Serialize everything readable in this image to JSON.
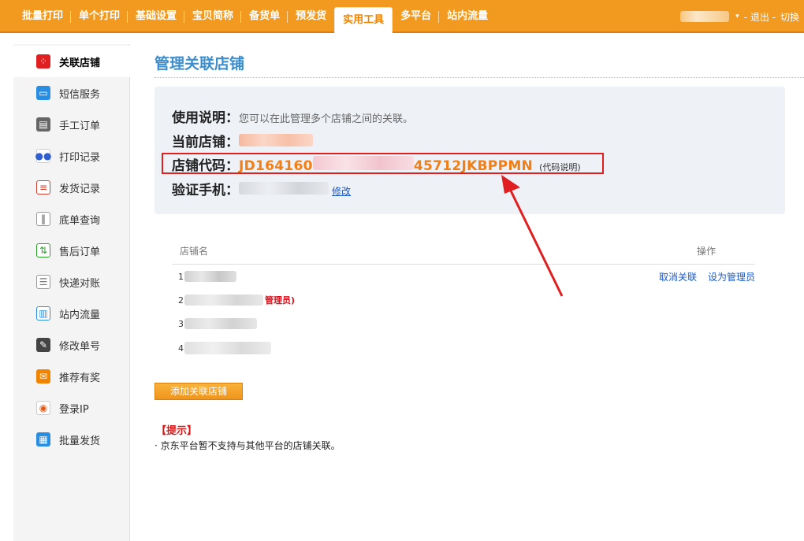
{
  "nav": {
    "items": [
      "批量打印",
      "单个打印",
      "基础设置",
      "宝贝简称",
      "备货单",
      "预发货",
      "实用工具",
      "多平台",
      "站内流量"
    ],
    "active_index": 6
  },
  "user": {
    "caret": "▾",
    "logout": "- 退出 -",
    "switch": "切换"
  },
  "sidebar": {
    "items": [
      {
        "label": "关联店铺",
        "icon": "store-link-icon",
        "color": "#e02020",
        "active": true
      },
      {
        "label": "短信服务",
        "icon": "sms-icon",
        "color": "#2a8ee0"
      },
      {
        "label": "手工订单",
        "icon": "printer-icon",
        "color": "#666666"
      },
      {
        "label": "打印记录",
        "icon": "print-record-icon",
        "color": "#3060d0"
      },
      {
        "label": "发货记录",
        "icon": "shipping-record-icon",
        "color": "#d04030"
      },
      {
        "label": "底单查询",
        "icon": "barcode-icon",
        "color": "#666666"
      },
      {
        "label": "售后订单",
        "icon": "after-sale-icon",
        "color": "#2aa02a"
      },
      {
        "label": "快递对账",
        "icon": "reconcile-icon",
        "color": "#777777"
      },
      {
        "label": "站内流量",
        "icon": "traffic-chart-icon",
        "color": "#2a8ee0"
      },
      {
        "label": "修改单号",
        "icon": "edit-pencil-icon",
        "color": "#444444"
      },
      {
        "label": "推荐有奖",
        "icon": "reward-envelope-icon",
        "color": "#f08300"
      },
      {
        "label": "登录IP",
        "icon": "login-ip-icon",
        "color": "#e05a1a"
      },
      {
        "label": "批量发货",
        "icon": "batch-ship-icon",
        "color": "#2a8ee0"
      }
    ]
  },
  "page": {
    "title": "管理关联店铺"
  },
  "info": {
    "usage_key": "使用说明：",
    "usage_val": "您可以在此管理多个店铺之间的关联。",
    "current_key": "当前店铺：",
    "code_key": "店铺代码：",
    "code_start": "JD164160",
    "code_end": "45712JKBPPMN",
    "code_note": "(代码说明)",
    "phone_key": "验证手机：",
    "phone_edit": "修改"
  },
  "table": {
    "header_name": "店铺名",
    "header_op": "操作",
    "rows": [
      "1",
      "2",
      "3",
      "4"
    ],
    "admin_tag": "管理员)",
    "action_unlink": "取消关联",
    "action_set_admin": "设为管理员"
  },
  "add_button": "添加关联店铺",
  "tips": {
    "title": "【提示】",
    "text": "· 京东平台暂不支持与其他平台的店铺关联。"
  },
  "colors": {
    "accent_orange": "#f29a1f",
    "title_blue": "#3a8ed0",
    "highlight_red": "#e02020",
    "code_orange": "#f07f17"
  }
}
